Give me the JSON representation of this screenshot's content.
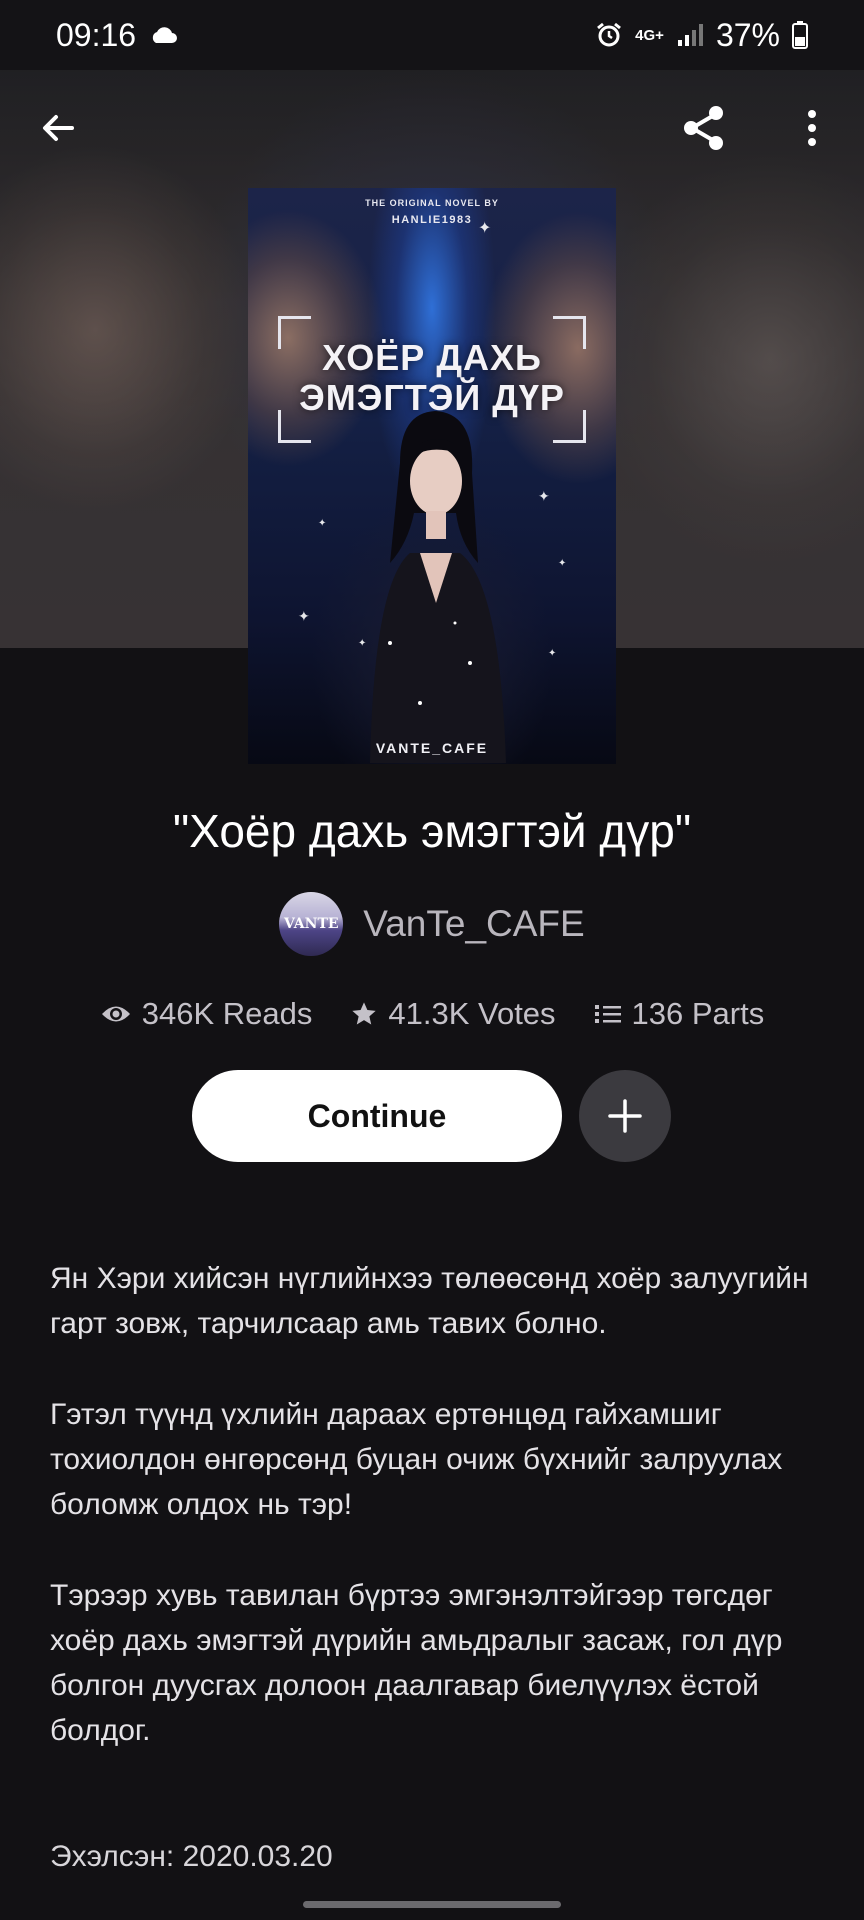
{
  "status_bar": {
    "time": "09:16",
    "network": "4G+",
    "battery": "37%"
  },
  "book": {
    "title": "\"Хоёр дахь эмэгтэй дүр\"",
    "cover": {
      "top_line": "THE ORIGINAL NOVEL BY",
      "author_line": "HANLIE1983",
      "title_line1": "ХОЁР ДАХЬ",
      "title_line2": "ЭМЭГТЭЙ ДҮР",
      "footer": "VANTE_CAFE"
    },
    "author": {
      "name": "VanTe_CAFE",
      "avatar_text": "VANTE"
    },
    "stats": {
      "reads": "346K Reads",
      "votes": "41.3K Votes",
      "parts": "136 Parts"
    },
    "continue_label": "Continue",
    "description": [
      "Ян Хэри хийсэн нүглийнхээ төлөөсөнд хоёр залуугийн гарт зовж, тарчилсаар амь тавих болно.",
      "Гэтэл түүнд үхлийн дараах ертөнцөд гайхамшиг тохиолдон өнгөрсөнд буцан очиж бүхнийг залруулах боломж олдох нь тэр!",
      "Тэрээр хувь тавилан бүртээ эмгэнэлтэйгээр төгсдөг хоёр дахь эмэгтэй дүрийн амьдралыг засаж, гол дүр болгон дуусгах долоон даалгавар биелүүлэх ёстой болдог."
    ],
    "started": "Эхэлсэн: 2020.03.20"
  },
  "icons": {
    "back": "arrow-left-icon",
    "share": "share-icon",
    "more": "more-vertical-icon",
    "reads": "eye-icon",
    "votes": "star-icon",
    "parts": "list-icon",
    "add": "plus-icon"
  }
}
